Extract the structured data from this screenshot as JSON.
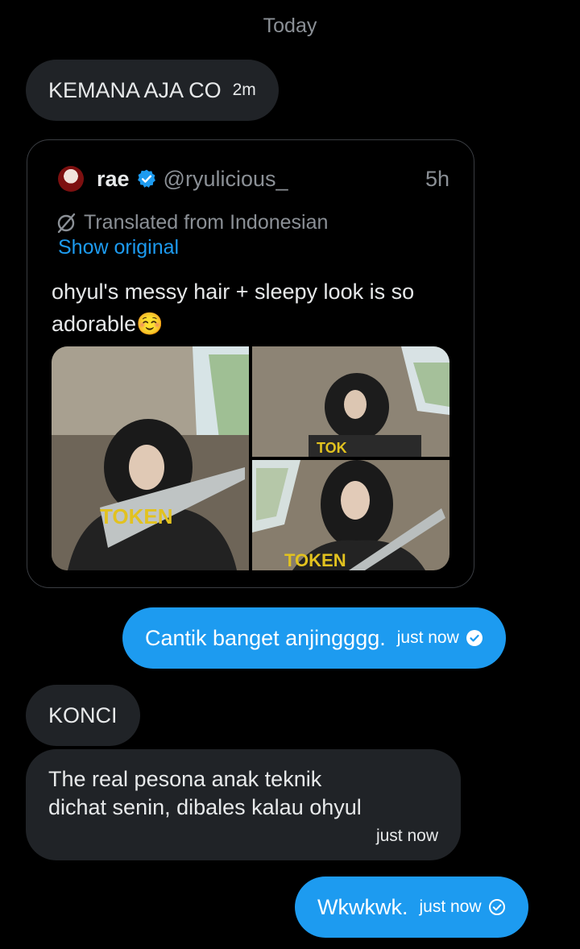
{
  "date_separator": "Today",
  "messages": [
    {
      "text": "KEMANA AJA CO",
      "time": "2m"
    },
    {
      "text": "Cantik banget anjingggg.",
      "time": "just now"
    },
    {
      "text": "KONCI"
    },
    {
      "line1": "The real pesona anak teknik",
      "line2": "dichat senin, dibales kalau ohyul",
      "time": "just now"
    },
    {
      "text": "Wkwkwk.",
      "time": "just now"
    }
  ],
  "quote": {
    "name": "rae",
    "handle": "@ryulicious_",
    "age": "5h",
    "translated_label": "Translated from Indonesian",
    "show_original": "Show original",
    "text": "ohyul's messy hair + sleepy look is so adorable☺️"
  },
  "colors": {
    "accent": "#1d9bf0",
    "incoming_bubble": "#202327",
    "muted_text": "#8b9096"
  }
}
